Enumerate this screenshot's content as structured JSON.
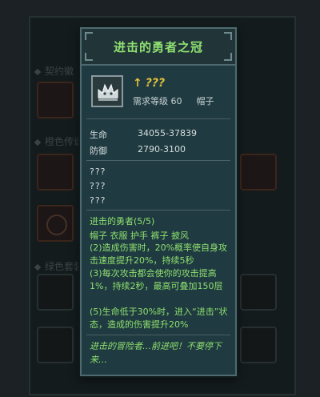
{
  "background": {
    "sections": [
      "契约徽",
      "橙色传说",
      "绿色套装"
    ]
  },
  "tooltip": {
    "title": "进击的勇者之冠",
    "item_name": "???",
    "level_req": "需求等级 60",
    "slot": "帽子",
    "stats": [
      {
        "label": "生命",
        "value": "34055-37839"
      },
      {
        "label": "防御",
        "value": "2790-3100"
      }
    ],
    "unknown_attrs": [
      "???",
      "???",
      "???"
    ],
    "set_name": "进击的勇者(5/5)",
    "set_pieces": "帽子 衣服 护手 裤子 披风",
    "set_effects": [
      "(2)造成伤害时，20%概率使自身攻击速度提升20%，持续5秒",
      "(3)每次攻击都会使你的攻击提高1%，持续2秒，最高可叠加150层",
      "(5)生命低于30%时，进入“进击”状态，造成的伤害提升20%"
    ],
    "flavor": "进击的冒险者…前进吧！不要停下来…",
    "colors": {
      "title": "#8fe070",
      "item_name": "#e0c23a",
      "set_text": "#8fe070",
      "panel_bg": "#1f3a40"
    },
    "icons": [
      "item-name-arrow-icon",
      "crown-item-icon"
    ]
  }
}
